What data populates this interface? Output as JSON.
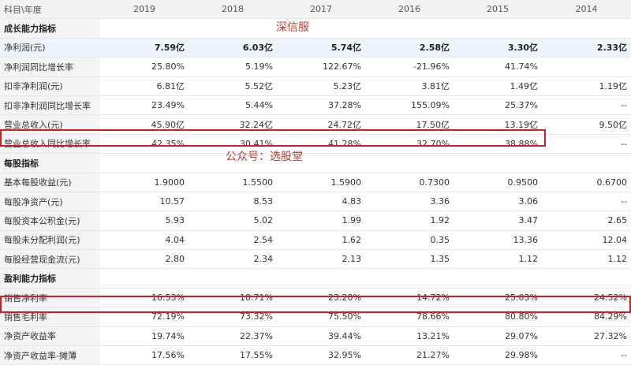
{
  "header": {
    "label": "科目\\年度",
    "years": [
      "2019",
      "2018",
      "2017",
      "2016",
      "2015",
      "2014"
    ]
  },
  "rows": [
    {
      "type": "section",
      "label": "成长能力指标"
    },
    {
      "type": "highlight",
      "label": "净利润(元)",
      "values": [
        "7.59亿",
        "6.03亿",
        "5.74亿",
        "2.58亿",
        "3.30亿",
        "2.33亿"
      ]
    },
    {
      "type": "data",
      "label": "净利润同比增长率",
      "values": [
        "25.80%",
        "5.19%",
        "122.67%",
        "-21.96%",
        "41.74%",
        ""
      ]
    },
    {
      "type": "data",
      "label": "扣非净利润(元)",
      "values": [
        "6.81亿",
        "5.52亿",
        "5.23亿",
        "3.81亿",
        "1.49亿",
        "1.19亿"
      ]
    },
    {
      "type": "data",
      "label": "扣非净利润同比增长率",
      "values": [
        "23.49%",
        "5.44%",
        "37.28%",
        "155.09%",
        "25.37%",
        "--"
      ]
    },
    {
      "type": "data",
      "label": "营业总收入(元)",
      "values": [
        "45.90亿",
        "32.24亿",
        "24.72亿",
        "17.50亿",
        "13.19亿",
        "9.50亿"
      ]
    },
    {
      "type": "data",
      "label": "营业总收入同比增长率",
      "values": [
        "42.35%",
        "30.41%",
        "41.28%",
        "32.70%",
        "38.88%",
        "--"
      ]
    },
    {
      "type": "section",
      "label": "每股指标"
    },
    {
      "type": "data",
      "label": "基本每股收益(元)",
      "values": [
        "1.9000",
        "1.5500",
        "1.5900",
        "0.7300",
        "0.9500",
        "0.6700"
      ]
    },
    {
      "type": "data",
      "label": "每股净资产(元)",
      "values": [
        "10.57",
        "8.53",
        "4.83",
        "3.36",
        "3.06",
        "--"
      ]
    },
    {
      "type": "data",
      "label": "每股资本公积金(元)",
      "values": [
        "5.93",
        "5.02",
        "1.99",
        "1.92",
        "3.47",
        "2.65"
      ]
    },
    {
      "type": "data",
      "label": "每股未分配利润(元)",
      "values": [
        "4.04",
        "2.54",
        "1.62",
        "0.35",
        "13.36",
        "12.04"
      ]
    },
    {
      "type": "data",
      "label": "每股经营现金流(元)",
      "values": [
        "2.80",
        "2.34",
        "2.13",
        "1.35",
        "1.12",
        "1.12"
      ]
    },
    {
      "type": "section",
      "label": "盈利能力指标"
    },
    {
      "type": "data",
      "label": "销售净利率",
      "values": [
        "16.53%",
        "18.71%",
        "23.20%",
        "14.72%",
        "25.03%",
        "24.52%"
      ]
    },
    {
      "type": "data",
      "label": "销售毛利率",
      "values": [
        "72.19%",
        "73.32%",
        "75.50%",
        "78.66%",
        "80.80%",
        "84.29%"
      ]
    },
    {
      "type": "data",
      "label": "净资产收益率",
      "values": [
        "19.74%",
        "22.37%",
        "39.44%",
        "13.21%",
        "29.07%",
        "27.32%"
      ]
    },
    {
      "type": "data",
      "label": "净资产收益率-摊薄",
      "values": [
        "17.56%",
        "17.55%",
        "32.95%",
        "21.27%",
        "29.98%",
        "--"
      ]
    }
  ],
  "watermarks": [
    "深信服",
    "公众号：选股堂"
  ],
  "colors": {
    "highlight_box": "#cc1f1f",
    "watermark": "#c0392b",
    "header_bg": "#f2f2f2",
    "highlight_row_bg": "#edf2fb"
  }
}
